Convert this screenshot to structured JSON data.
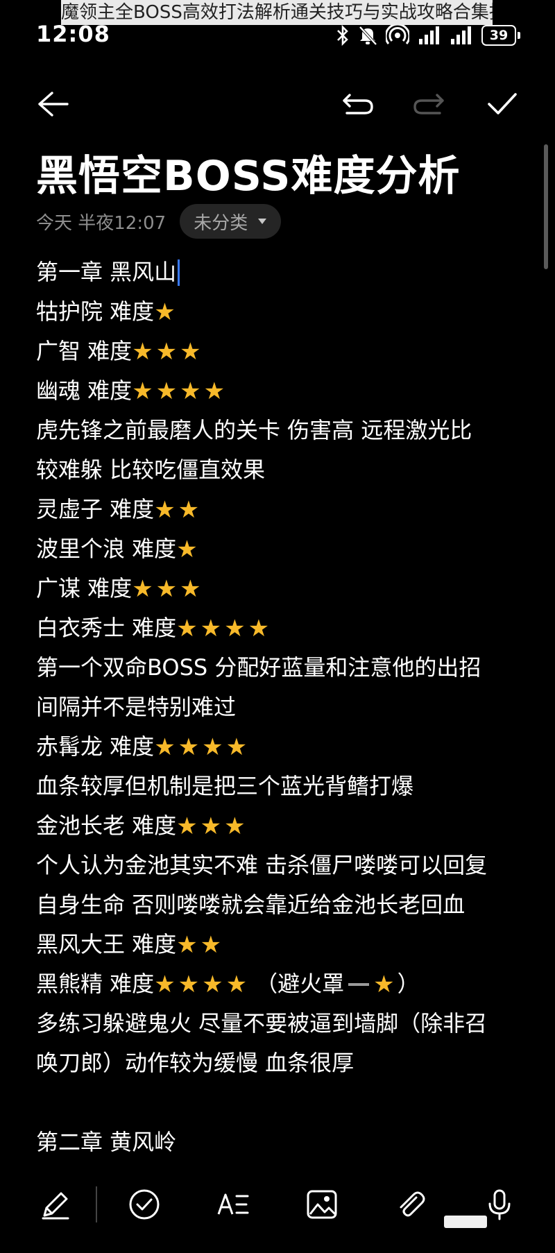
{
  "overlay_title": "魔领主全BOSS高效打法解析通关技巧与实战攻略合集指",
  "status": {
    "time": "12:08",
    "battery": "39",
    "icons": [
      "bluetooth-icon",
      "mute-icon",
      "hotspot-icon",
      "signal-icon",
      "signal-icon-2"
    ]
  },
  "toolbar": {
    "icons": [
      "back-arrow-icon",
      "undo-icon",
      "redo-icon",
      "check-icon"
    ]
  },
  "note": {
    "title": "黑悟空BOSS难度分析",
    "date": "今天 半夜12:07",
    "category": "未分类",
    "lines": [
      {
        "text": "第一章 黑风山",
        "stars": 0,
        "caret": true
      },
      {
        "text": "牯护院 难度",
        "stars": 1
      },
      {
        "text": "广智 难度",
        "stars": 3
      },
      {
        "text": "幽魂 难度",
        "stars": 4
      },
      {
        "text": "虎先锋之前最磨人的关卡 伤害高 远程激光比",
        "stars": 0
      },
      {
        "text": "较难躲 比较吃僵直效果",
        "stars": 0
      },
      {
        "text": "灵虚子 难度",
        "stars": 2
      },
      {
        "text": "波里个浪 难度",
        "stars": 1
      },
      {
        "text": "广谋 难度",
        "stars": 3
      },
      {
        "text": "白衣秀士 难度",
        "stars": 4
      },
      {
        "text": "第一个双命BOSS 分配好蓝量和注意他的出招",
        "stars": 0
      },
      {
        "text": "间隔并不是特别难过",
        "stars": 0
      },
      {
        "text": "赤髯龙 难度",
        "stars": 4
      },
      {
        "text": "血条较厚但机制是把三个蓝光背鳍打爆",
        "stars": 0
      },
      {
        "text": "金池长老 难度",
        "stars": 3
      },
      {
        "text": "个人认为金池其实不难 击杀僵尸喽喽可以回复",
        "stars": 0
      },
      {
        "text": "自身生命 否则喽喽就会靠近给金池长老回血",
        "stars": 0
      },
      {
        "text": "黑风大王 难度",
        "stars": 2
      },
      {
        "text": "黑熊精 难度",
        "stars": 4,
        "suffix_before": "（避火罩",
        "suffix_stars": 1,
        "suffix_after": "）"
      },
      {
        "text": "多练习躲避鬼火 尽量不要被逼到墙脚（除非召",
        "stars": 0
      },
      {
        "text": "唤刀郎）动作较为缓慢 血条很厚",
        "stars": 0
      },
      {
        "text": "",
        "stars": 0,
        "blank": true
      },
      {
        "text": "第二章 黄风岭",
        "stars": 0
      }
    ]
  },
  "bottombar": {
    "icons": [
      "pen-icon",
      "checklist-icon",
      "text-format-icon",
      "image-icon",
      "attachment-icon",
      "microphone-icon"
    ]
  },
  "colors": {
    "background": "#000000",
    "text": "#ffffff",
    "muted": "#8e8e8e",
    "star": "#f7b92a",
    "caret": "#3a7bff",
    "chip": "#252525"
  }
}
